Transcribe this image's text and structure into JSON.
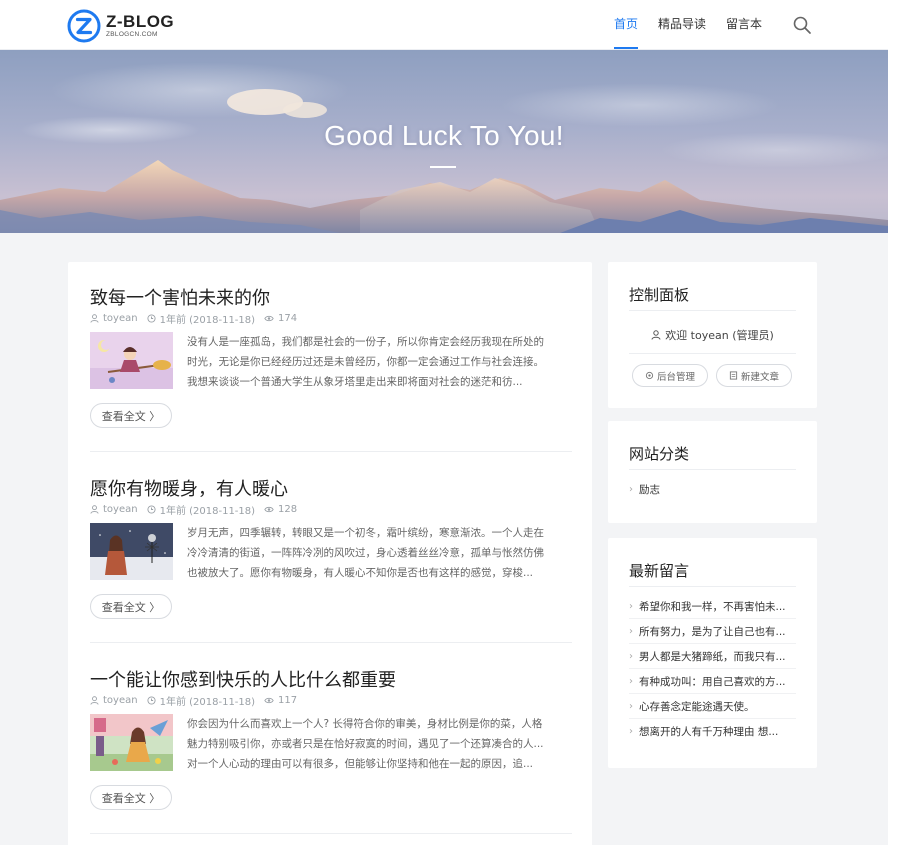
{
  "site": {
    "logo_title": "Z-BLOG",
    "logo_subtitle": "ZBLOGCN.COM",
    "brand_color": "#1e7af0"
  },
  "nav": {
    "items": [
      {
        "label": "首页",
        "active": true
      },
      {
        "label": "精品导读",
        "active": false
      },
      {
        "label": "留言本",
        "active": false
      }
    ],
    "search_icon": "search-icon"
  },
  "banner": {
    "title": "Good Luck To You!"
  },
  "posts": [
    {
      "title": "致每一个害怕未来的你",
      "author": "toyean",
      "date": "1年前 (2018-11-18)",
      "views": "174",
      "excerpt": [
        "没有人是一座孤岛，我们都是社会的一份子，所以你肯定会经历我现在所处的",
        "时光，无论是你已经经历过还是未曾经历，你都一定会通过工作与社会连接。",
        "我想来谈谈一个普通大学生从象牙塔里走出来即将面对社会的迷茫和彷..."
      ],
      "more": "查看全文 〉"
    },
    {
      "title": "愿你有物暖身，有人暖心",
      "author": "toyean",
      "date": "1年前 (2018-11-18)",
      "views": "128",
      "excerpt": [
        "岁月无声，四季辗转，转眼又是一个初冬，霜叶缤纷，寒意渐浓。一个人走在",
        "冷冷清清的街道，一阵阵冷冽的风吹过，身心透着丝丝冷意，孤单与怅然仿佛",
        "也被放大了。愿你有物暖身，有人暖心不知你是否也有这样的感觉，穿梭..."
      ],
      "more": "查看全文 〉"
    },
    {
      "title": "一个能让你感到快乐的人比什么都重要",
      "author": "toyean",
      "date": "1年前 (2018-11-18)",
      "views": "117",
      "excerpt": [
        "你会因为什么而喜欢上一个人? 长得符合你的审美，身材比例是你的菜，人格",
        "魅力特别吸引你，亦或者只是在恰好寂寞的时间，遇见了一个还算凑合的人...",
        "对一个人心动的理由可以有很多，但能够让你坚持和他在一起的原因，追..."
      ],
      "more": "查看全文 〉"
    }
  ],
  "sidebar": {
    "control": {
      "title": "控制面板",
      "welcome": "欢迎 toyean (管理员)",
      "admin_btn": "后台管理",
      "new_post_btn": "新建文章"
    },
    "categories": {
      "title": "网站分类",
      "items": [
        "励志"
      ]
    },
    "comments": {
      "title": "最新留言",
      "items": [
        "希望你和我一样，不再害怕未...",
        "所有努力，是为了让自己也有...",
        "男人都是大猪蹄纸，而我只有...",
        "有种成功叫：用自己喜欢的方...",
        "心存善念定能途遇天使。",
        "想离开的人有千万种理由 想..."
      ]
    }
  }
}
